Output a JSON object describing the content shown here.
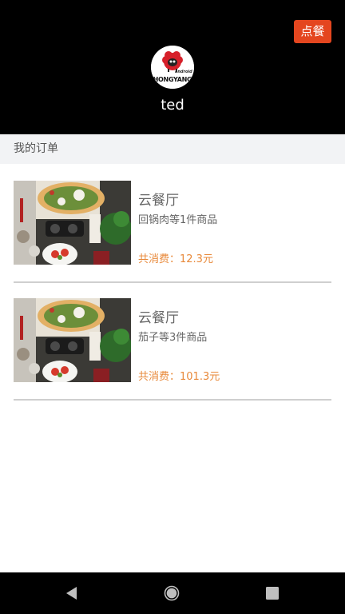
{
  "header": {
    "order_button_label": "点餐",
    "username": "ted",
    "avatar_logo_text": "HONGYANG",
    "avatar_logo_small": "android"
  },
  "section": {
    "title": "我的订单"
  },
  "orders": [
    {
      "restaurant": "云餐厅",
      "items_summary": "回锅肉等1件商品",
      "total": "共消费：12.3元"
    },
    {
      "restaurant": "云餐厅",
      "items_summary": "茄子等3件商品",
      "total": "共消费：101.3元"
    }
  ],
  "navbar": {
    "back_icon": "back-triangle-icon",
    "home_icon": "home-circle-icon",
    "recent_icon": "recent-square-icon"
  },
  "colors": {
    "header_bg": "#000000",
    "accent_button": "#e4461f",
    "price_text": "#e8893a",
    "section_bg": "#f2f3f5"
  }
}
